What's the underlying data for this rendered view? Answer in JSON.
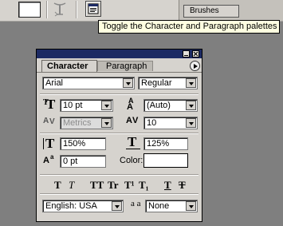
{
  "toolbar": {
    "tooltip": "Toggle the Character and Paragraph palettes",
    "brushes_tab": "Brushes",
    "icons": [
      "foreground-color-swatch",
      "warp-text-icon",
      "toggle-palettes-icon"
    ]
  },
  "palette": {
    "tabs": {
      "active": "Character",
      "inactive": "Paragraph"
    },
    "font_family": "Arial",
    "font_style": "Regular",
    "font_size": "10 pt",
    "leading": "(Auto)",
    "kerning": "Metrics",
    "tracking": "10",
    "vertical_scale": "150%",
    "horizontal_scale": "125%",
    "baseline_shift": "0 pt",
    "color_label": "Color:",
    "language": "English: USA",
    "antialias_icon_text": "a a",
    "antialias": "None",
    "style_buttons": [
      "T",
      "T",
      "TT",
      "Tr",
      "T¹",
      "T₁",
      "T",
      "T"
    ]
  },
  "colors": {
    "title_bar": "#1c2a63",
    "tooltip_bg": "#ffffe1",
    "chrome": "#d6d3ce"
  }
}
